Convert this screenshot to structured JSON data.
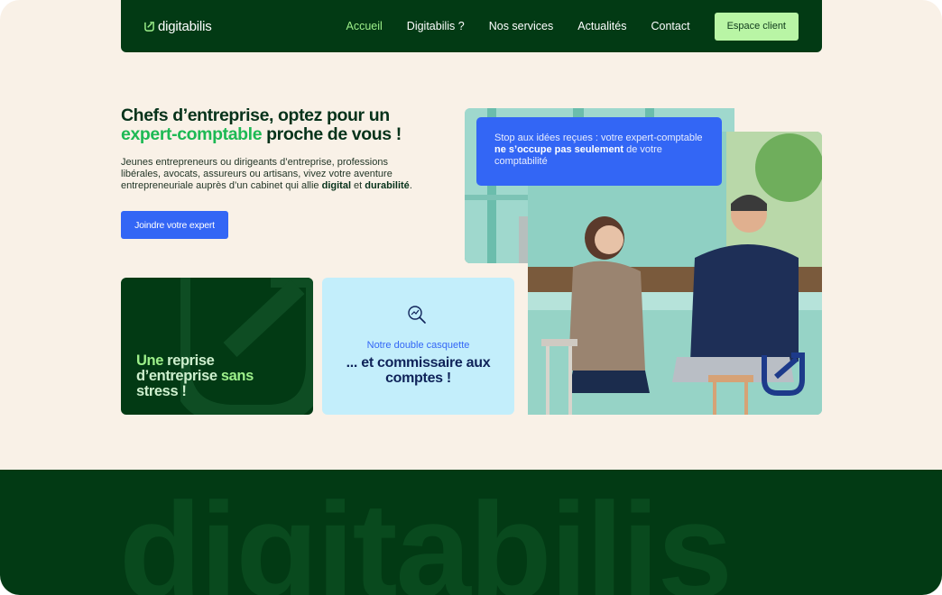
{
  "header": {
    "logo_text": "digitabilis",
    "nav": [
      {
        "label": "Accueil",
        "active": true
      },
      {
        "label": "Digitabilis ?",
        "active": false
      },
      {
        "label": "Nos services",
        "active": false
      },
      {
        "label": "Actualités",
        "active": false
      },
      {
        "label": "Contact",
        "active": false
      }
    ],
    "client_button": "Espace client"
  },
  "hero": {
    "title_part1": "Chefs d’entreprise, optez pour un",
    "title_accent": "expert-comptable",
    "title_part2": " proche de vous !",
    "text_main": "Jeunes entrepreneurs ou dirigeants d’entreprise, professions libérales, avocats, assureurs ou artisans, vivez votre aventure entrepreneuriale auprès d’un cabinet qui allie ",
    "text_bold1": "digital",
    "text_and": " et ",
    "text_bold2": "durabilité",
    "text_end": ".",
    "cta_label": "Joindre votre expert"
  },
  "card_green": {
    "line1_light": "Une",
    "line1_rest": " reprise",
    "line2": "d’entreprise ",
    "line2_light": "sans",
    "line3": "stress !"
  },
  "card_blue": {
    "icon": "search-chart-icon",
    "small_label": "Notre double casquette",
    "big_label": "... et commissaire aux comptes !"
  },
  "quote": {
    "text_start": "Stop aux idées reçues : votre expert-comptable ",
    "text_bold": "ne s’occupe pas seulement",
    "text_end": " de votre comptabilité"
  },
  "footer": {
    "watermark_text": "digitabilis"
  },
  "colors": {
    "dark_green": "#023a14",
    "bright_green": "#1db954",
    "light_green": "#b9f5a5",
    "blue": "#3366f5",
    "light_blue": "#c3eefb",
    "cream": "#f9f1e7"
  }
}
